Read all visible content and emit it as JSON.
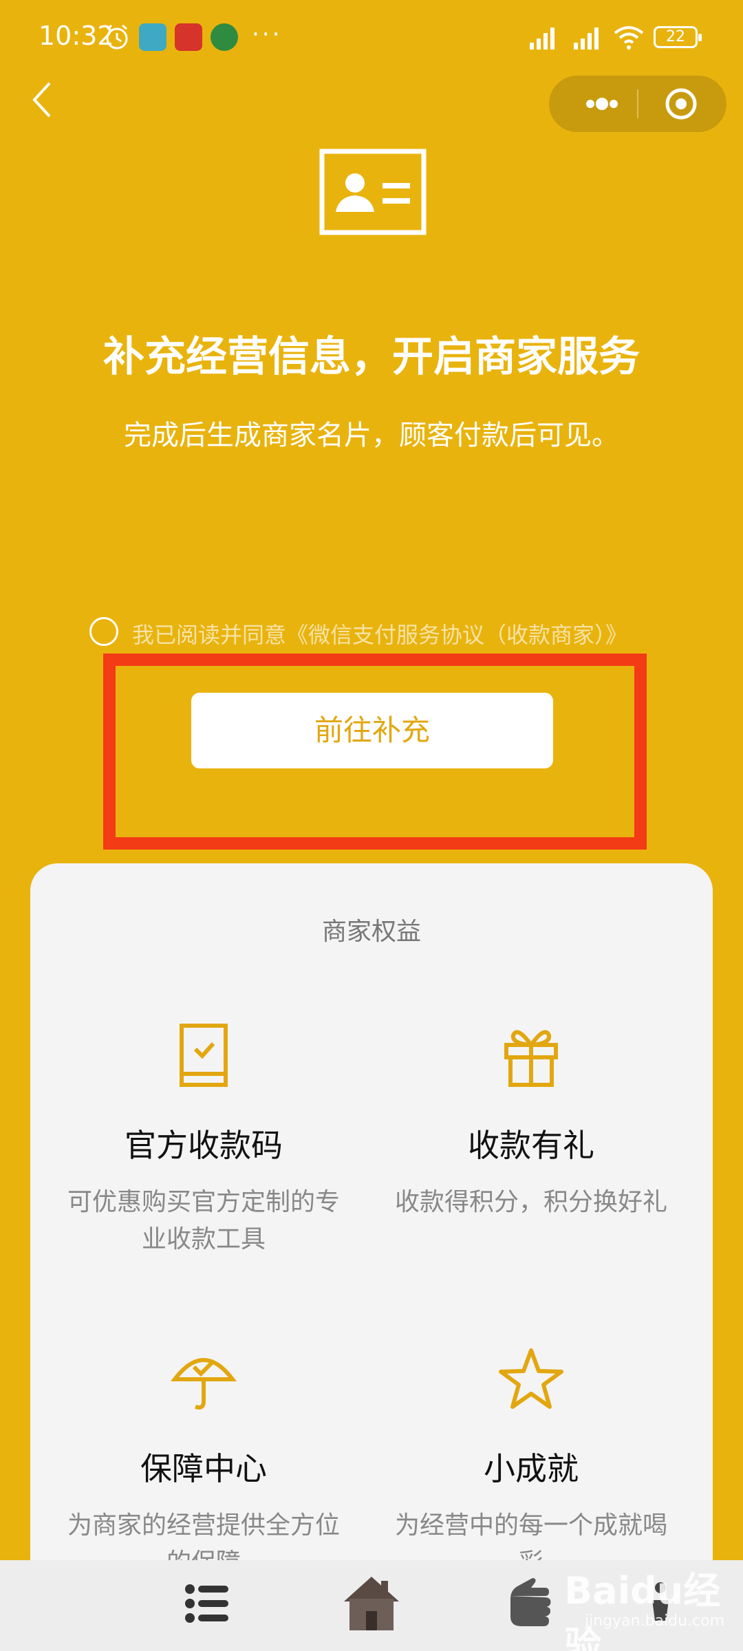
{
  "status_bar": {
    "time": "10:32",
    "more": "···",
    "battery": "22"
  },
  "header": {
    "title": "补充经营信息，开启商家服务",
    "subtitle": "完成后生成商家名片，顾客付款后可见。"
  },
  "agreement": {
    "text": "我已阅读并同意《微信支付服务协议（收款商家）》"
  },
  "primary_button": {
    "label": "前往补充"
  },
  "benefits": {
    "title": "商家权益",
    "items": [
      {
        "title": "官方收款码",
        "desc": "可优惠购买官方定制的专业收款工具",
        "icon": "official-qr-icon"
      },
      {
        "title": "收款有礼",
        "desc": "收款得积分，积分换好礼",
        "icon": "gift-icon"
      },
      {
        "title": "保障中心",
        "desc": "为商家的经营提供全方位的保障",
        "icon": "umbrella-icon"
      },
      {
        "title": "小成就",
        "desc": "为经营中的每一个成就喝彩",
        "icon": "star-icon"
      }
    ]
  },
  "watermark": {
    "text": "Baidu经验",
    "sub": "jingyan.baidu.com"
  },
  "colors": {
    "background": "#E9B30E",
    "highlight": "#F33B15",
    "button_text": "#E2A710"
  }
}
